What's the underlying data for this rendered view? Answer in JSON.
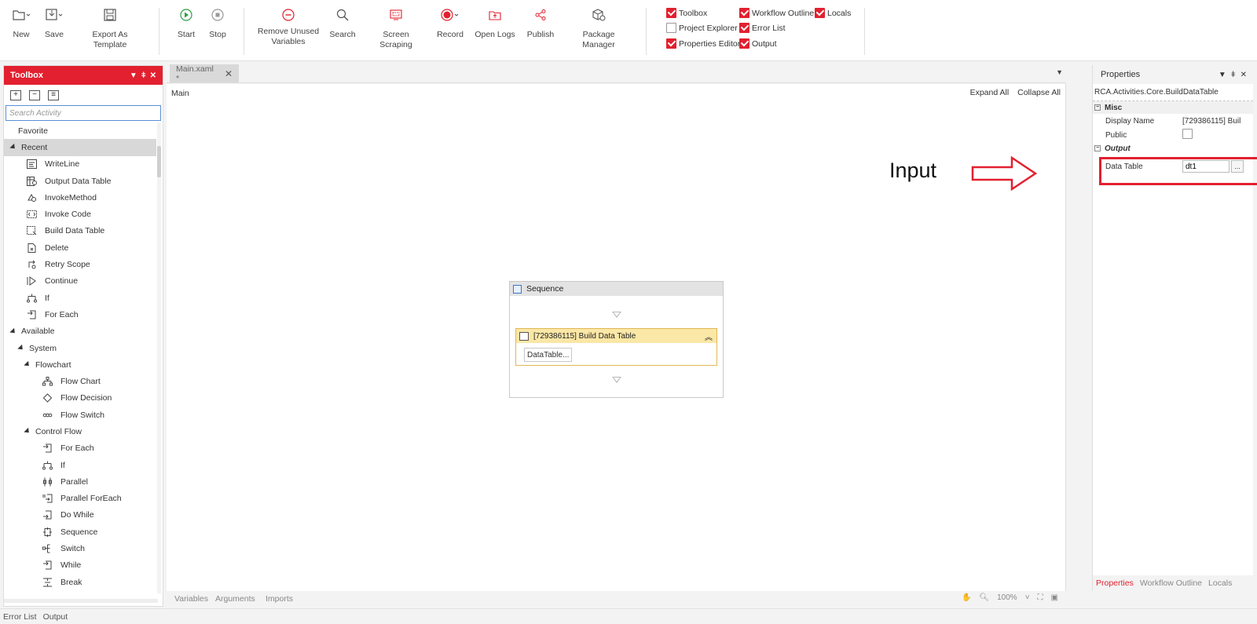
{
  "ribbon": {
    "buttons": [
      {
        "id": "new",
        "label": "New",
        "icon": "folder-plus-icon"
      },
      {
        "id": "save",
        "label": "Save",
        "icon": "save-icon"
      },
      {
        "id": "export",
        "label": "Export As Template",
        "icon": "export-template-icon"
      },
      {
        "id": "start",
        "label": "Start",
        "icon": "play-icon"
      },
      {
        "id": "stop",
        "label": "Stop",
        "icon": "stop-icon"
      },
      {
        "id": "remove_unused",
        "label": "Remove Unused\nVariables",
        "icon": "remove-icon"
      },
      {
        "id": "search",
        "label": "Search",
        "icon": "search-icon"
      },
      {
        "id": "screen_scraping",
        "label": "Screen Scraping",
        "icon": "screen-scraping-icon"
      },
      {
        "id": "record",
        "label": "Record",
        "icon": "record-icon"
      },
      {
        "id": "open_logs",
        "label": "Open Logs",
        "icon": "folder-open-icon"
      },
      {
        "id": "publish",
        "label": "Publish",
        "icon": "share-icon"
      },
      {
        "id": "package_manager",
        "label": "Package Manager",
        "icon": "package-icon"
      }
    ],
    "panels": [
      {
        "label": "Toolbox",
        "checked": true
      },
      {
        "label": "Project Explorer",
        "checked": false
      },
      {
        "label": "Properties Editor",
        "checked": true
      },
      {
        "label": "Workflow Outline",
        "checked": true
      },
      {
        "label": "Error List",
        "checked": true
      },
      {
        "label": "Output",
        "checked": true
      },
      {
        "label": "Locals",
        "checked": true
      }
    ],
    "accent": "#e2202f"
  },
  "toolbox": {
    "title": "Toolbox",
    "search_placeholder": "Search Activity",
    "favorite": "Favorite",
    "recent": "Recent",
    "recent_items": [
      "WriteLine",
      "Output Data Table",
      "InvokeMethod",
      "Invoke Code",
      "Build Data Table",
      "Delete",
      "Retry Scope",
      "Continue",
      "If",
      "For Each"
    ],
    "available": "Available",
    "system": "System",
    "flowchart": "Flowchart",
    "flowchart_items": [
      "Flow Chart",
      "Flow Decision",
      "Flow Switch"
    ],
    "control_flow": "Control Flow",
    "control_flow_items": [
      "For Each",
      "If",
      "Parallel",
      "Parallel ForEach",
      "Do While",
      "Sequence",
      "Switch",
      "While",
      "Break"
    ]
  },
  "designer": {
    "tab": "Main.xaml *",
    "breadcrumb": "Main",
    "expand_all": "Expand All",
    "collapse_all": "Collapse All",
    "annotation": "Input",
    "sequence_title": "Sequence",
    "activity_title": "[729386115] Build Data Table",
    "activity_button": "DataTable...",
    "bottom_tabs": [
      "Variables",
      "Arguments",
      "Imports"
    ],
    "zoom": "100%"
  },
  "properties": {
    "title": "Properties",
    "type_name": "RCA.Activities.Core.BuildDataTable",
    "misc": "Misc",
    "display_name_label": "Display Name",
    "display_name_value": "[729386115] Buil",
    "public_label": "Public",
    "output": "Output",
    "data_table_label": "Data Table",
    "data_table_value": "dt1",
    "bottom_tabs": [
      "Properties",
      "Workflow Outline",
      "Locals"
    ]
  },
  "statusbar": {
    "tabs": [
      "Error List",
      "Output"
    ]
  }
}
